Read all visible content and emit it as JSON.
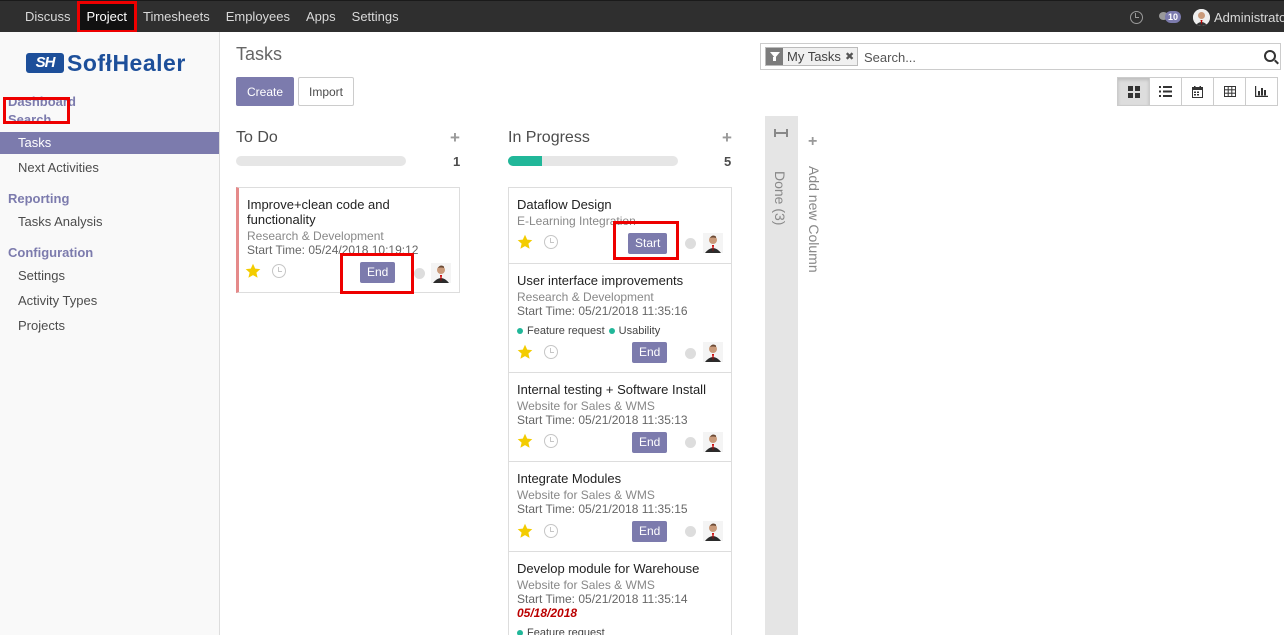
{
  "topbar": {
    "menu": [
      "Discuss",
      "Project",
      "Timesheets",
      "Employees",
      "Apps",
      "Settings"
    ],
    "active": "Project",
    "message_count": "10",
    "user": "Administrator"
  },
  "sidebar": {
    "logo": {
      "mark": "SH",
      "word": "SofłHealer"
    },
    "dashboard": "Dashboard",
    "search": "Search",
    "tasks": "Tasks",
    "next_activities": "Next Activities",
    "reporting": "Reporting",
    "tasks_analysis": "Tasks Analysis",
    "configuration": "Configuration",
    "settings": "Settings",
    "activity_types": "Activity Types",
    "projects": "Projects"
  },
  "control": {
    "title": "Tasks",
    "create": "Create",
    "import": "Import",
    "facet": "My Tasks",
    "search_placeholder": "Search..."
  },
  "views": [
    "kanban",
    "list",
    "calendar",
    "pivot",
    "graph"
  ],
  "columns": {
    "todo": {
      "title": "To Do",
      "count": "1",
      "progress": 0
    },
    "inprogress": {
      "title": "In Progress",
      "count": "5",
      "progress": 0.2
    },
    "done": {
      "title": "Done (3)"
    },
    "add": "Add new Column"
  },
  "cards": {
    "todo1": {
      "title_l1": "Improve+clean code and",
      "title_l2": "functionality",
      "project": "Research & Development",
      "start": "Start Time: 05/24/2018 10:19:12",
      "button": "End"
    },
    "ip1": {
      "title": "Dataflow Design",
      "project": "E-Learning Integration",
      "button": "Start"
    },
    "ip2": {
      "title": "User interface improvements",
      "project": "Research & Development",
      "start": "Start Time: 05/21/2018 11:35:16",
      "tag1": "Feature request",
      "tag2": "Usability",
      "button": "End"
    },
    "ip3": {
      "title": "Internal testing + Software Install",
      "project": "Website for Sales & WMS",
      "start": "Start Time: 05/21/2018 11:35:13",
      "button": "End"
    },
    "ip4": {
      "title": "Integrate Modules",
      "project": "Website for Sales & WMS",
      "start": "Start Time: 05/21/2018 11:35:15",
      "button": "End"
    },
    "ip5": {
      "title": "Develop module for Warehouse",
      "project": "Website for Sales & WMS",
      "start": "Start Time: 05/21/2018 11:35:14",
      "deadline": "05/18/2018",
      "tag1": "Feature request"
    }
  },
  "colors": {
    "brand": "#7c7bad",
    "highlight": "#e00000",
    "progress": "#21b799",
    "star": "#f3cc00",
    "deadline": "#bb0000"
  }
}
